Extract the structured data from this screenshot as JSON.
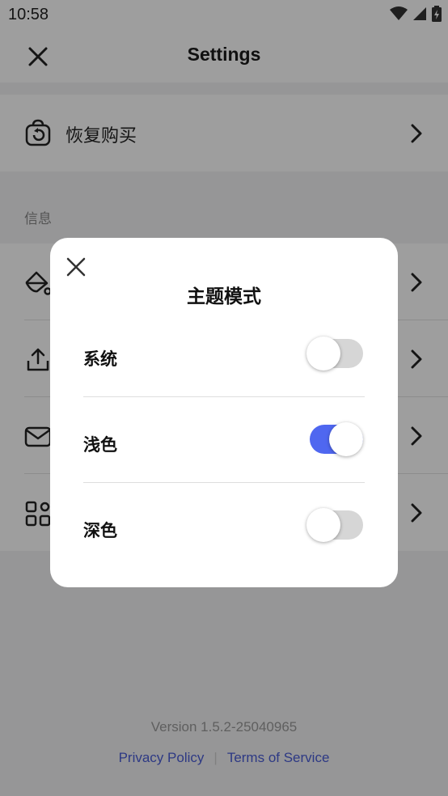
{
  "status_bar": {
    "time": "10:58"
  },
  "header": {
    "title": "Settings"
  },
  "restore": {
    "label": "恢复购买"
  },
  "section": {
    "label": "信息"
  },
  "dialog": {
    "title": "主题模式",
    "options": [
      {
        "label": "系统",
        "enabled": false
      },
      {
        "label": "浅色",
        "enabled": true
      },
      {
        "label": "深色",
        "enabled": false
      }
    ]
  },
  "footer": {
    "version": "Version 1.5.2-25040965",
    "privacy": "Privacy Policy",
    "separator": "|",
    "terms": "Terms of Service"
  },
  "colors": {
    "accent": "#4f67f0",
    "link": "#4a5cd6"
  }
}
